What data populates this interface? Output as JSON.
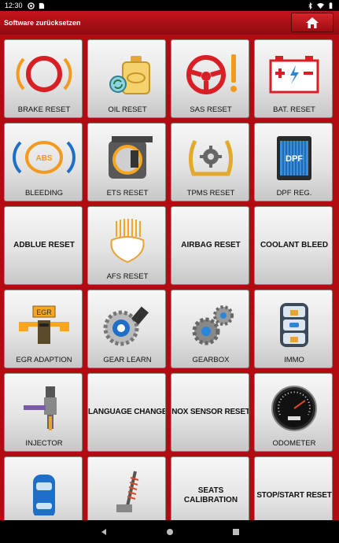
{
  "status_bar": {
    "time": "12:30"
  },
  "header": {
    "title": "Software zurücksetzen",
    "home_icon": "home-icon"
  },
  "tiles": [
    {
      "label": "BRAKE RESET",
      "icon": "brake-warning-icon"
    },
    {
      "label": "OIL RESET",
      "icon": "oil-can-icon"
    },
    {
      "label": "SAS RESET",
      "icon": "steering-wheel-warning-icon"
    },
    {
      "label": "BAT. RESET",
      "icon": "battery-icon"
    },
    {
      "label": "BLEEDING",
      "icon": "abs-icon"
    },
    {
      "label": "ETS RESET",
      "icon": "throttle-body-icon"
    },
    {
      "label": "TPMS RESET",
      "icon": "tire-pressure-icon"
    },
    {
      "label": "DPF REG.",
      "icon": "dpf-filter-icon"
    },
    {
      "label": "ADBLUE RESET"
    },
    {
      "label": "AFS RESET",
      "icon": "headlight-icon"
    },
    {
      "label": "AIRBAG RESET"
    },
    {
      "label": "COOLANT BLEED"
    },
    {
      "label": "EGR ADAPTION",
      "icon": "egr-valve-icon"
    },
    {
      "label": "GEAR LEARN",
      "icon": "gear-sensor-icon"
    },
    {
      "label": "GEARBOX",
      "icon": "gears-icon"
    },
    {
      "label": "IMMO",
      "icon": "car-key-lock-icon"
    },
    {
      "label": "INJECTOR",
      "icon": "injector-icon"
    },
    {
      "label": "LANGUAGE CHANGE"
    },
    {
      "label": "NOX SENSOR RESET"
    },
    {
      "label": "ODOMETER",
      "icon": "speedometer-icon"
    },
    {
      "label": "",
      "icon": "car-top-view-icon"
    },
    {
      "label": "",
      "icon": "suspension-icon"
    },
    {
      "label": "SEATS CALIBRATION"
    },
    {
      "label": "STOP/START RESET"
    }
  ],
  "nav": {
    "back": "back-icon",
    "home": "home-circle-icon",
    "recents": "recents-icon"
  }
}
